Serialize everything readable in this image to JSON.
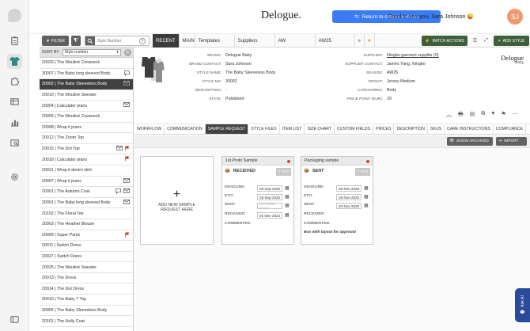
{
  "header": {
    "brand": "Delogue.",
    "classic_button": "Return to classic version",
    "greeting": "Good to see you, Sara Johnson 😜",
    "avatar_initials": "SJ"
  },
  "toolbar": {
    "filter_label": "FILTER",
    "search_placeholder": "Style Number",
    "view_tabs": [
      "RECENT",
      "MAIN",
      "Templates",
      "Suppliers",
      "AW",
      "AW25"
    ],
    "active_view": "RECENT",
    "batch_actions": "BATCH ACTIONS",
    "add_style": "ADD STYLE"
  },
  "sidebar": {
    "sort_label": "SORT BY",
    "sort_value": "Style number",
    "items": [
      {
        "label": "20020 | The Mouliné Crewneck"
      },
      {
        "label": "30007 | The Baby long sleeved Body",
        "icons": [
          "chat-icon"
        ]
      },
      {
        "label": "30002 | The Baby Sleeveless Body",
        "icons": [
          "mail-icon"
        ]
      },
      {
        "label": "20010 | The Mouliné Sweater"
      },
      {
        "label": "20004 | Calculator jeans",
        "icons": [
          "mail-icon"
        ]
      },
      {
        "label": "20006 | The Mouliné Crewneck"
      },
      {
        "label": "20008 | Wrap it jeans"
      },
      {
        "label": "20012 | The Zoom Top"
      },
      {
        "label": "20015 | The Dot Top",
        "icons": [
          "mail-icon",
          "flag-icon"
        ]
      },
      {
        "label": "20018 | Calculator jeans",
        "icons": [
          "flag-icon"
        ]
      },
      {
        "label": "20021 | Wrap it denim skirt"
      },
      {
        "label": "20007 | Wrap it jeans",
        "icons": [
          "mail-icon"
        ]
      },
      {
        "label": "20001 | The Autumn Coat",
        "icons": [
          "chat-icon",
          "mail-icon"
        ]
      },
      {
        "label": "30001 | The Baby long sleeved Body",
        "icons": [
          "mail-icon"
        ]
      },
      {
        "label": "20102 | The Floral Tee"
      },
      {
        "label": "20003 | The Heather Blouse"
      },
      {
        "label": "20009 | Super Pants",
        "icons": [
          "flag-icon"
        ]
      },
      {
        "label": "20011 | Switch Dress"
      },
      {
        "label": "20027 | Switch Dress"
      },
      {
        "label": "20025 | The Mouliné Sweater"
      },
      {
        "label": "20013 | The Dress"
      },
      {
        "label": "20014 | The Dot Dress"
      },
      {
        "label": "30010 | The Baby T Top"
      },
      {
        "label": "30005 | The Baby Sleeveless Body"
      },
      {
        "label": "20101 | The Holly Coat"
      }
    ]
  },
  "details": {
    "brand_label": "BRAND:",
    "brand": "Delogue Baby",
    "brand_contact_label": "BRAND CONTACT:",
    "brand_contact": "Sara Johnson",
    "style_name_label": "STYLE NAME:",
    "style_name": "The Baby Sleeveless Body",
    "style_no_label": "STYLE NO:",
    "style_no": "30002",
    "description_label": "DESCRIPTION:",
    "description": "-",
    "state_label": "STATE:",
    "state": "Published",
    "supplier_label": "SUPPLIER:",
    "supplier": "Ningbo garment supplier (0)",
    "supplier_contact_label": "SUPPLIER CONTACT:",
    "supplier_contact": "James Yang, Ningbo",
    "season_label": "SEASON:",
    "season": "AW25",
    "group_label": "GROUP:",
    "group": "Jersey Medium",
    "categories_label": "CATEGORIES:",
    "categories": "Body",
    "price_point_label": "PRICE POINT (EUR):",
    "price_point": "29",
    "logo_text": "Delogue",
    "logo_sub": "Baby"
  },
  "page_tabs": [
    "WORKFLOW",
    "COMMUNICATION",
    "SAMPLE REQUEST",
    "STYLE FILES",
    "ITEM LIST",
    "SIZE CHART",
    "CUSTOM FIELDS",
    "PRICES",
    "DESCRIPTION",
    "SKUS",
    "CARE INSTRUCTIONS",
    "COMPLIANCE"
  ],
  "active_tab": "SAMPLE REQUEST",
  "archive_bar": {
    "show_archived": "SHOW ARCHIVED",
    "import": "IMPORT"
  },
  "add_sample": {
    "line1": "ADD NEW SAMPLE",
    "line2": "REQUEST HERE"
  },
  "sample_cards": [
    {
      "title": "1st Proto Sample",
      "status": "RECEIVED",
      "pcs": "1 PCS",
      "deadline_label": "DEADLINE:",
      "deadline": "06-Sep-2025",
      "eto_label": "ETO:",
      "eto": "03-Sep-2025",
      "sent_label": "SENT:",
      "sent": "DD-MMM-YYYY",
      "received_label": "RECEIVED:",
      "received": "01-Dec-2024",
      "commented_label": "COMMENTED:",
      "comment": ""
    },
    {
      "title": "Packaging sample",
      "status": "SENT",
      "pcs": "1 PCS",
      "deadline_label": "DEADLINE:",
      "deadline": "28-Nov-2025",
      "eto_label": "ETO:",
      "eto": "25-Nov-2025",
      "sent_label": "SENT:",
      "sent": "20-Nov-2025",
      "received_label": "RECEIVED:",
      "received": "",
      "commented_label": "COMMENTED:",
      "comment": "Box with layout for approval"
    }
  ],
  "ask_ai": "Ask AI",
  "colors": {
    "accent_blue": "#3b7bf4",
    "teal": "#2e8a88",
    "dark": "#404040",
    "green_button": "#3f5e3c",
    "flag_red": "#c0392b",
    "avatar": "#ef9a6e"
  }
}
